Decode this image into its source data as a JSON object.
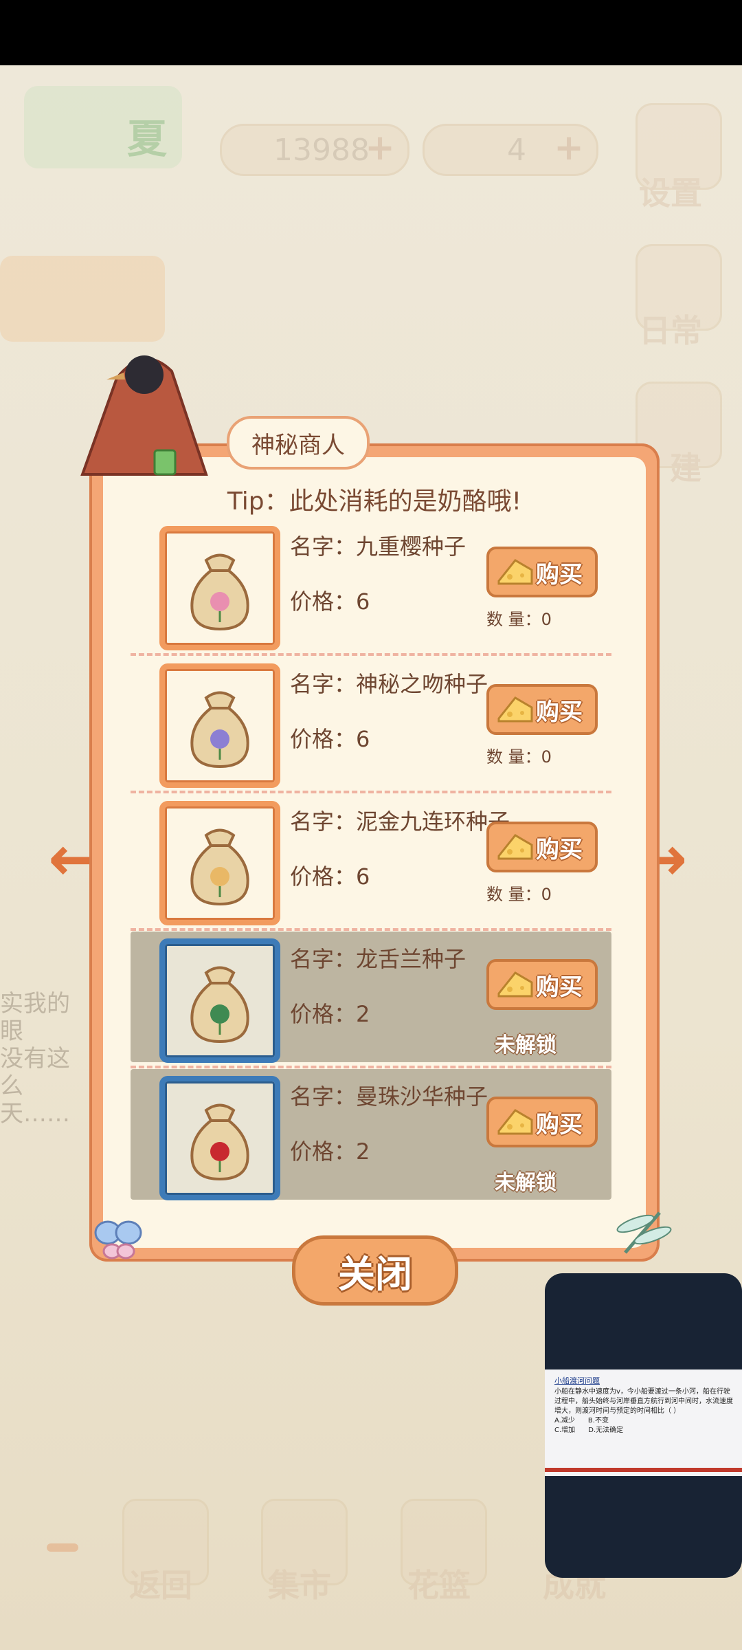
{
  "top_bar": {
    "season_label": "夏",
    "fish_currency": "13988",
    "cheese_currency": "4",
    "settings_label": "设置",
    "daily_label": "日常",
    "build_label": "建"
  },
  "dialog": {
    "title": "神秘商人",
    "tip": "Tip：此处消耗的是奶酪哦!",
    "name_prefix": "名字：",
    "price_prefix": "价格：",
    "buy_label": "购买",
    "close_label": "关闭",
    "items": [
      {
        "name": "名字：九重樱种子",
        "price": "价格：6",
        "qty": "数 量：0",
        "locked": false,
        "flower_color": "#e98fb0"
      },
      {
        "name": "名字：神秘之吻种子",
        "price": "价格：6",
        "qty": "数 量：0",
        "locked": false,
        "flower_color": "#8c7fd3"
      },
      {
        "name": "名字：泥金九连环种子",
        "price": "价格：6",
        "qty": "数 量：0",
        "locked": false,
        "flower_color": "#e9b866"
      },
      {
        "name": "名字：龙舌兰种子",
        "price": "价格：2",
        "status": "未解锁",
        "locked": true,
        "flower_color": "#3f8a52"
      },
      {
        "name": "名字：曼珠沙华种子",
        "price": "价格：2",
        "status": "未解锁",
        "locked": true,
        "flower_color": "#c8282f"
      }
    ]
  },
  "bottom_nav": {
    "back": "返回",
    "market": "集市",
    "basket": "花篮",
    "achievement": "成就"
  },
  "background_text": {
    "line1": "实我的眼",
    "line2": "没有这么",
    "line3": "天……"
  },
  "video_overlay": {
    "slide_title": "小船渡河问题",
    "slide_body": "小船在静水中速度为v，今小船要渡过一条小河，船在行驶过程中，船头始终与河岸垂直方航行到河中间时，水流速度增大，则渡河时间与预定的时间相比（ ）",
    "option_a": "A.减少",
    "option_b": "B.不变",
    "option_c": "C.增加",
    "option_d": "D.无法确定"
  }
}
